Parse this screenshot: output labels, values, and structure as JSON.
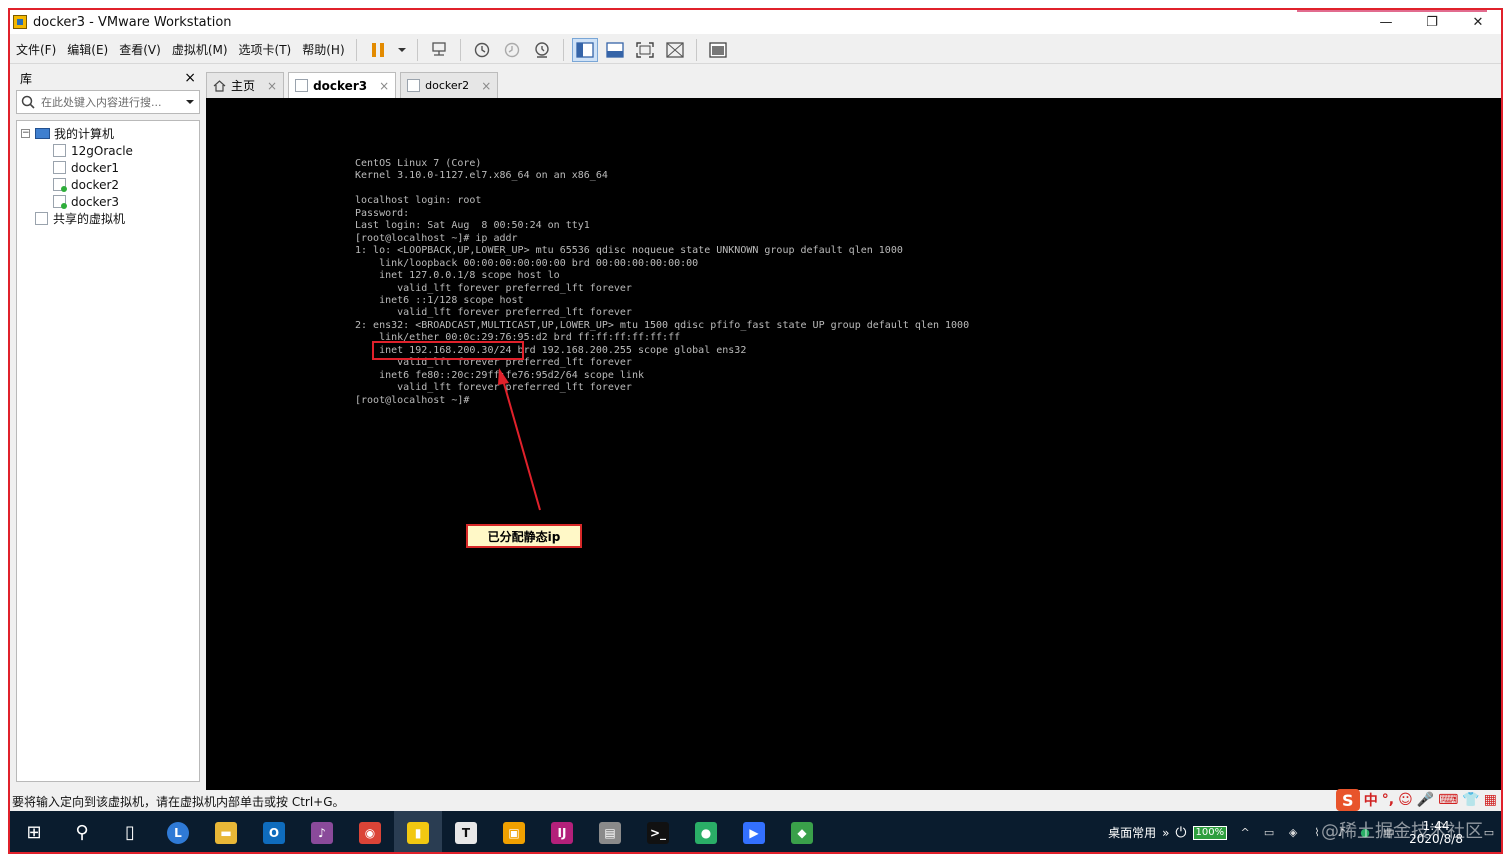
{
  "window": {
    "title": "docker3 - VMware Workstation",
    "controls": {
      "minimize": "—",
      "restore": "❐",
      "close": "✕"
    }
  },
  "menu": [
    "文件(F)",
    "编辑(E)",
    "查看(V)",
    "虚拟机(M)",
    "选项卡(T)",
    "帮助(H)"
  ],
  "library": {
    "title": "库",
    "close": "×",
    "search_placeholder": "在此处键入内容进行搜...",
    "tree": {
      "my_computer": "我的计算机",
      "vms": [
        "12gOracle",
        "docker1",
        "docker2",
        "docker3"
      ],
      "shared": "共享的虚拟机",
      "expander": "−"
    }
  },
  "tabs": [
    {
      "label": "主页",
      "close": "×"
    },
    {
      "label": "docker3",
      "close": "×"
    },
    {
      "label": "docker2",
      "close": "×"
    }
  ],
  "console": {
    "lines": [
      "CentOS Linux 7 (Core)",
      "Kernel 3.10.0-1127.el7.x86_64 on an x86_64",
      "",
      "localhost login: root",
      "Password:",
      "Last login: Sat Aug  8 00:50:24 on tty1",
      "[root@localhost ~]# ip addr",
      "1: lo: <LOOPBACK,UP,LOWER_UP> mtu 65536 qdisc noqueue state UNKNOWN group default qlen 1000",
      "    link/loopback 00:00:00:00:00:00 brd 00:00:00:00:00:00",
      "    inet 127.0.0.1/8 scope host lo",
      "       valid_lft forever preferred_lft forever",
      "    inet6 ::1/128 scope host",
      "       valid_lft forever preferred_lft forever",
      "2: ens32: <BROADCAST,MULTICAST,UP,LOWER_UP> mtu 1500 qdisc pfifo_fast state UP group default qlen 1000",
      "    link/ether 00:0c:29:76:95:d2 brd ff:ff:ff:ff:ff:ff",
      "    inet 192.168.200.30/24 brd 192.168.200.255 scope global ens32",
      "       valid_lft forever preferred_lft forever",
      "    inet6 fe80::20c:29ff:fe76:95d2/64 scope link",
      "       valid_lft forever preferred_lft forever",
      "[root@localhost ~]#"
    ],
    "annotation": "已分配静态ip"
  },
  "status": {
    "hint": "要将输入定向到该虚拟机，请在虚拟机内部单击或按 Ctrl+G。"
  },
  "ime": {
    "logo": "S",
    "glyphs": [
      "中",
      "°,",
      "☺",
      "🎤",
      "⌨",
      "👕",
      "▦"
    ]
  },
  "taskbar": {
    "apps": [
      {
        "name": "windows-start",
        "glyph": "⊞",
        "color": "#0a1c2e"
      },
      {
        "name": "search",
        "glyph": "⚲",
        "color": "#0a1c2e"
      },
      {
        "name": "task-view",
        "glyph": "▯",
        "color": "#0a1c2e"
      },
      {
        "name": "lync",
        "glyph": "L",
        "color": "#2f7ad6"
      },
      {
        "name": "file-explorer",
        "glyph": "▬",
        "color": "#e8b737"
      },
      {
        "name": "outlook",
        "glyph": "O",
        "color": "#0f6cbd"
      },
      {
        "name": "app-purple",
        "glyph": "♪",
        "color": "#8a4a9a"
      },
      {
        "name": "chrome",
        "glyph": "◉",
        "color": "#db4437"
      },
      {
        "name": "powerbi",
        "glyph": "▮",
        "color": "#f2c811"
      },
      {
        "name": "typora",
        "glyph": "T",
        "color": "#e8e8e8"
      },
      {
        "name": "vmware",
        "glyph": "▣",
        "color": "#f0a000"
      },
      {
        "name": "intellij",
        "glyph": "IJ",
        "color": "#b3207a"
      },
      {
        "name": "app-window",
        "glyph": "▤",
        "color": "#8a8a8a"
      },
      {
        "name": "terminal",
        "glyph": ">_",
        "color": "#111111"
      },
      {
        "name": "wechat",
        "glyph": "●",
        "color": "#2aae67"
      },
      {
        "name": "feishu",
        "glyph": "▶",
        "color": "#3370ff"
      },
      {
        "name": "app-diamond",
        "glyph": "◆",
        "color": "#3aa04a"
      }
    ],
    "tray_label": "桌面常用",
    "tray_more": "»",
    "battery": "100%",
    "tray_glyphs": [
      "^",
      "▭",
      "◈",
      "⌇",
      "♪",
      "●",
      "中"
    ],
    "time": "1:44",
    "date": "2020/8/8",
    "watermark": "@稀土掘金技术社区"
  }
}
